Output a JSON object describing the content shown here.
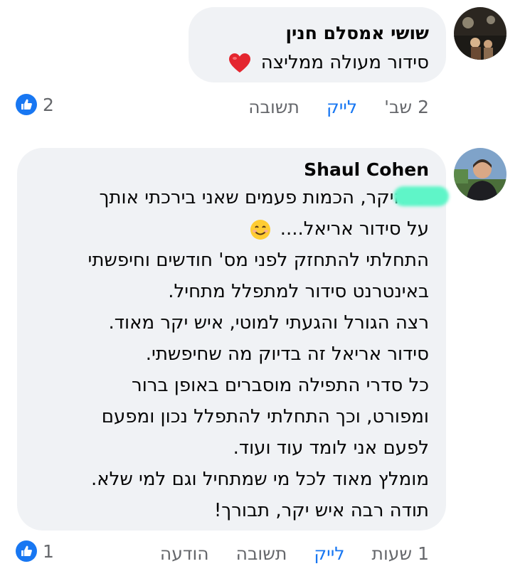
{
  "comment1": {
    "author": "שושי אמסלם חנין",
    "text": "סידור מעולה ממליצה",
    "time": "2 שב'",
    "like_label": "לייק",
    "reply_label": "תשובה",
    "reactions_count": "2",
    "emoji": "heart-emoji"
  },
  "comment2": {
    "author": "Shaul Cohen",
    "lines": [
      "שי היקר, הכמות פעמים שאני בירכתי אותך",
      "על סידור אריאל....",
      "התחלתי להתחזק לפני מס' חודשים וחיפשתי",
      "באינטרנט סידור למתפלל מתחיל.",
      "רצה הגורל והגעתי למוטי, איש יקר מאוד.",
      "סידור אריאל זה בדיוק מה שחיפשתי.",
      "כל סדרי התפילה מוסברים באופן ברור",
      "ומפורט, וכך התחלתי להתפלל נכון ומפעם",
      "לפעם אני לומד עוד ועוד.",
      "מומלץ מאוד לכל מי שמתחיל וגם למי שלא.",
      "תודה רבה איש יקר, תבורך!"
    ],
    "time": "1 שעות",
    "like_label": "לייק",
    "reply_label": "תשובה",
    "message_label": "הודעה",
    "reactions_count": "1",
    "emoji": "smiling-face-emoji"
  },
  "colors": {
    "bubble": "#f0f2f5",
    "like_blue": "#1877f2",
    "meta_gray": "#65676b",
    "redaction": "#5ff5c8"
  }
}
